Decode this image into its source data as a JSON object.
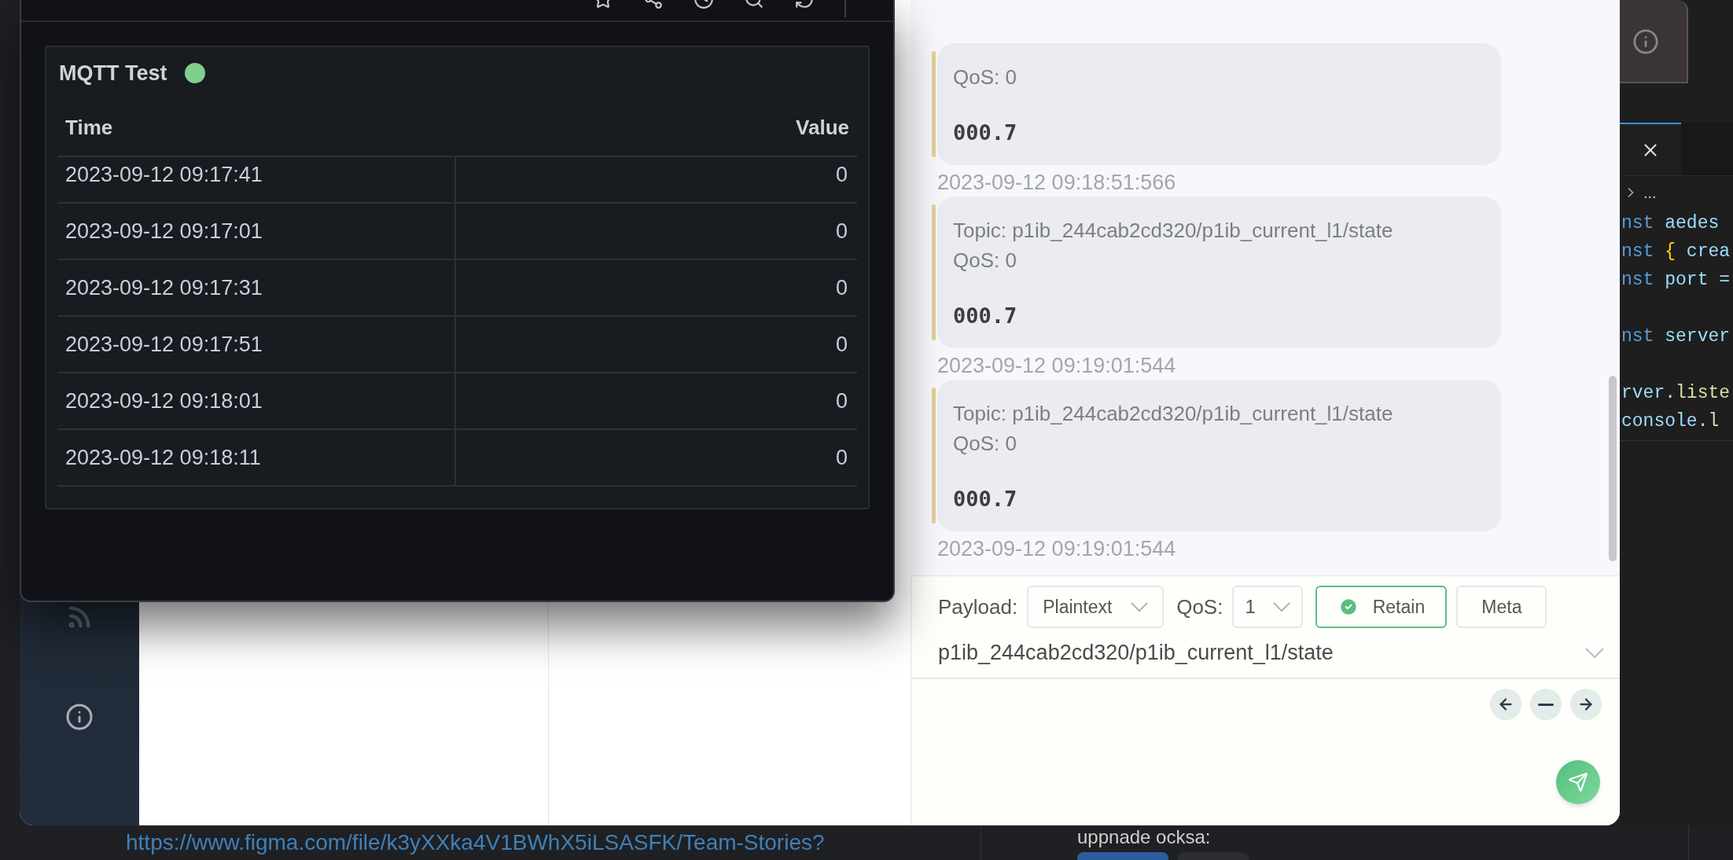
{
  "dashboard_window": {
    "panel": {
      "title": "MQTT Test",
      "color": "#7fd08f",
      "table": {
        "columns": [
          "Time",
          "Value"
        ],
        "rows": [
          {
            "time": "2023-09-12 09:17:41",
            "value": "0"
          },
          {
            "time": "2023-09-12 09:17:01",
            "value": "0"
          },
          {
            "time": "2023-09-12 09:17:31",
            "value": "0"
          },
          {
            "time": "2023-09-12 09:17:51",
            "value": "0"
          },
          {
            "time": "2023-09-12 09:18:01",
            "value": "0"
          },
          {
            "time": "2023-09-12 09:18:11",
            "value": "0"
          }
        ]
      }
    }
  },
  "mqtt_window": {
    "sidebar": {
      "items": [
        {
          "kind": "feed"
        },
        {
          "kind": "info"
        }
      ]
    },
    "messages": [
      {
        "qos": "QoS: 0",
        "payload": "000.7",
        "time": "2023-09-12 09:18:51:566"
      },
      {
        "topic": "Topic: p1ib_244cab2cd320/p1ib_current_l1/state",
        "qos": "QoS: 0",
        "payload": "000.7",
        "time": "2023-09-12 09:19:01:544"
      },
      {
        "topic": "Topic: p1ib_244cab2cd320/p1ib_current_l1/state",
        "qos": "QoS: 0",
        "payload": "000.7",
        "time": "2023-09-12 09:19:01:544"
      }
    ],
    "composer": {
      "payload_label": "Payload:",
      "payload_format": "Plaintext",
      "qos_label": "QoS:",
      "qos": "1",
      "retain": {
        "label": "Retain",
        "checked": true
      },
      "meta": "Meta",
      "topic": "p1ib_244cab2cd320/p1ib_current_l1/state",
      "history_buttons": [
        {
          "kind": "previous"
        },
        {
          "kind": "clear"
        },
        {
          "kind": "next"
        }
      ]
    }
  },
  "editor": {
    "breadcrumb": "...",
    "code_lines": [
      {
        "tokens": [
          {
            "text": "nst ",
            "kind": "keyword"
          },
          {
            "text": "aedes",
            "kind": "variable"
          }
        ]
      },
      {
        "tokens": [
          {
            "text": "nst ",
            "kind": "keyword"
          },
          {
            "text": "{ ",
            "kind": "bracket"
          },
          {
            "text": "crea",
            "kind": "variable"
          }
        ]
      },
      {
        "tokens": [
          {
            "text": "nst ",
            "kind": "keyword"
          },
          {
            "text": "port =",
            "kind": "variable"
          }
        ]
      },
      {
        "blank_before": true,
        "tokens": [
          {
            "text": "nst ",
            "kind": "keyword"
          },
          {
            "text": "server",
            "kind": "variable"
          }
        ]
      },
      {
        "blank_before": true,
        "tokens": [
          {
            "text": "rver",
            "kind": "variable"
          },
          {
            "text": ".liste",
            "kind": "function"
          }
        ]
      },
      {
        "tokens": [
          {
            "text": "console",
            "kind": "variable"
          },
          {
            "text": ".l",
            "kind": "function"
          }
        ]
      }
    ]
  },
  "chat": {
    "link": "https://www.figma.com/file/k3yXXka4V1BWhX5iLSASFK/Team-Stories?",
    "text": "uppnade ocksa:"
  }
}
